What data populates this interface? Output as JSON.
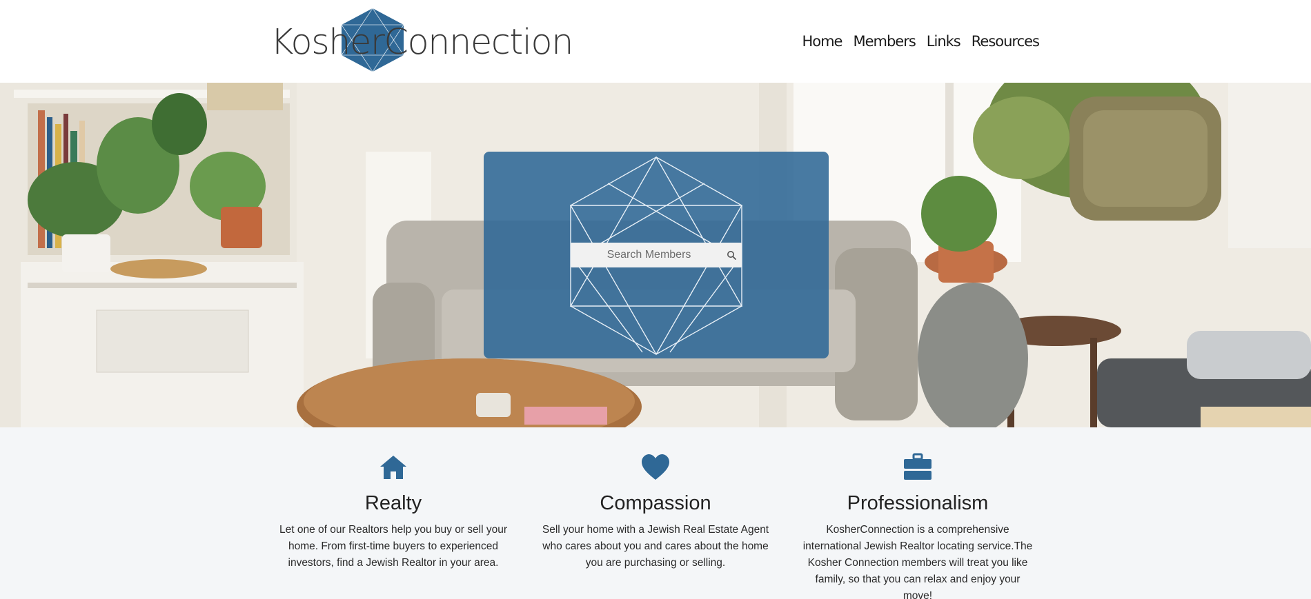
{
  "brand": {
    "logo_part1": "Kosher",
    "logo_part2": "Connection",
    "accent_color": "#2f6896"
  },
  "nav": {
    "items": [
      {
        "label": "Home"
      },
      {
        "label": "Members"
      },
      {
        "label": "Links"
      },
      {
        "label": "Resources"
      }
    ]
  },
  "search": {
    "placeholder": "Search Members",
    "button_icon": "search-icon"
  },
  "features": [
    {
      "icon": "home-icon",
      "title": "Realty",
      "text": "Let one of our Realtors help you buy or sell your home. From first-time buyers to experienced investors, find a Jewish Realtor in your area."
    },
    {
      "icon": "heart-icon",
      "title": "Compassion",
      "text": "Sell your home with a Jewish Real Estate Agent who cares about you and cares about the home you are purchasing or selling."
    },
    {
      "icon": "briefcase-icon",
      "title": "Professionalism",
      "text": "KosherConnection is a comprehensive international Jewish Realtor locating service.The Kosher Connection members will treat you like family, so that you can relax and enjoy your move!"
    }
  ]
}
